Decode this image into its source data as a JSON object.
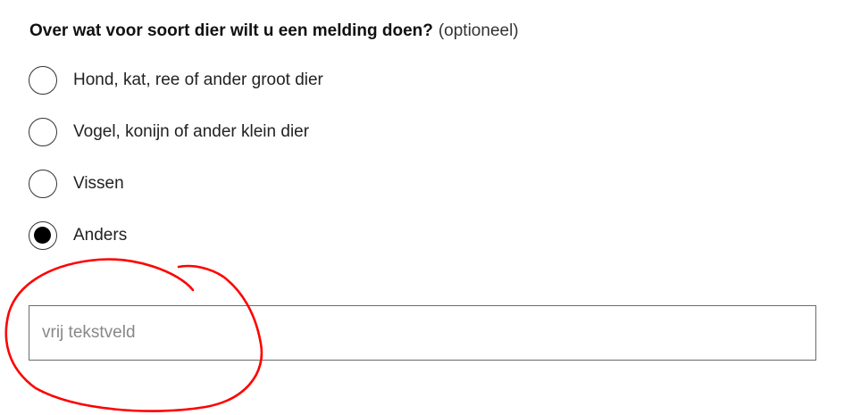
{
  "question": {
    "text": "Over wat voor soort dier wilt u een melding doen?",
    "optional_label": "(optioneel)"
  },
  "options": [
    {
      "label": "Hond, kat, ree of ander groot dier",
      "selected": false
    },
    {
      "label": "Vogel, konijn of ander klein dier",
      "selected": false
    },
    {
      "label": "Vissen",
      "selected": false
    },
    {
      "label": "Anders",
      "selected": true
    }
  ],
  "free_text": {
    "placeholder": "vrij tekstveld",
    "value": ""
  },
  "annotation": {
    "color": "#ff0000"
  }
}
